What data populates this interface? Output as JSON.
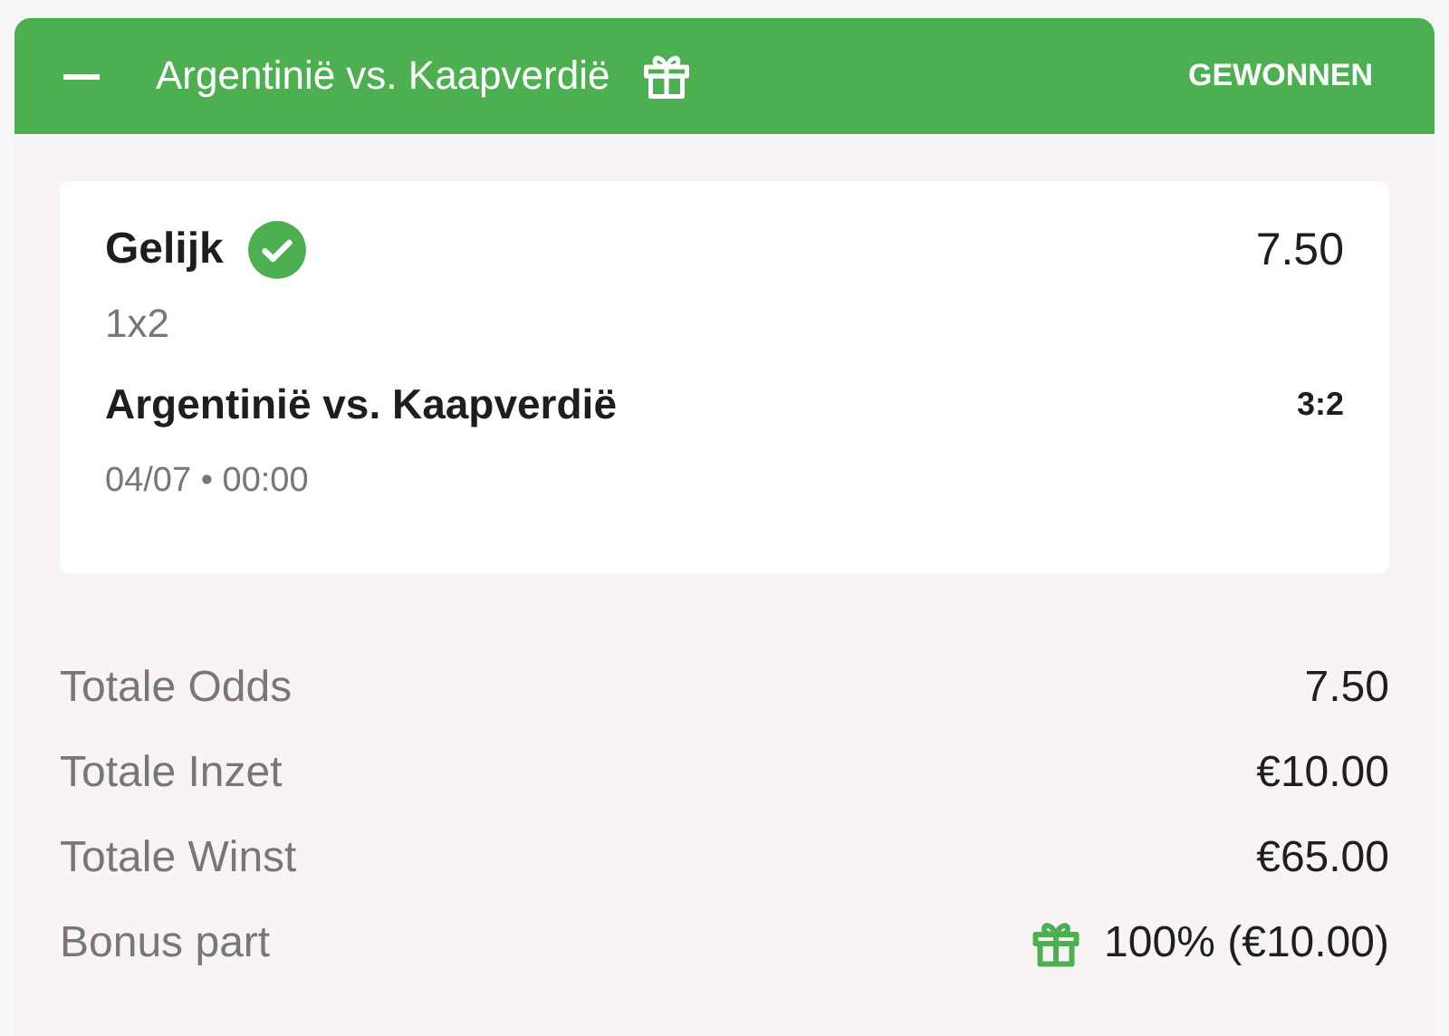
{
  "header": {
    "expanded": true,
    "title": "Argentinië vs. Kaapverdië",
    "status": "GEWONNEN"
  },
  "selection": {
    "pick": "Gelijk",
    "won": true,
    "odds": "7.50",
    "market": "1x2",
    "match": "Argentinië vs. Kaapverdië",
    "score": "3:2",
    "datetime": "04/07 • 00:00"
  },
  "summary": [
    {
      "kind": "plain",
      "label": "Totale Odds",
      "value": "7.50"
    },
    {
      "kind": "plain",
      "label": "Totale Inzet",
      "value": "€10.00"
    },
    {
      "kind": "plain",
      "label": "Totale Winst",
      "value": "€65.00"
    },
    {
      "kind": "bonus",
      "label": "Bonus part",
      "value": "100% (€10.00)"
    }
  ]
}
